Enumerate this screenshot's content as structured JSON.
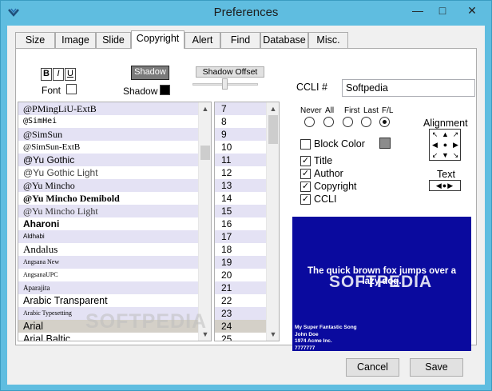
{
  "window": {
    "title": "Preferences"
  },
  "tabs": [
    {
      "label": "Size",
      "active": false
    },
    {
      "label": "Image",
      "active": false
    },
    {
      "label": "Slide",
      "active": false
    },
    {
      "label": "Copyright",
      "active": true
    },
    {
      "label": "Alert",
      "active": false
    },
    {
      "label": "Find",
      "active": false
    },
    {
      "label": "Database",
      "active": false
    },
    {
      "label": "Misc.",
      "active": false
    }
  ],
  "font_controls": {
    "bold": "B",
    "italic": "I",
    "underline": "U",
    "font_label": "Font",
    "shadow_button": "Shadow",
    "shadow_label": "Shadow",
    "shadow_offset_button": "Shadow Offset",
    "shadow_color": "#000000",
    "font_color": "#ffffff"
  },
  "font_list": [
    {
      "name": "@PMingLiU-ExtB",
      "style": "serif",
      "selected": false
    },
    {
      "name": "@SimHei",
      "style": "sans-narrow",
      "selected": false
    },
    {
      "name": "@SimSun",
      "style": "serif",
      "selected": false
    },
    {
      "name": "@SimSun-ExtB",
      "style": "serif",
      "selected": false
    },
    {
      "name": "@Yu Gothic",
      "style": "sans",
      "selected": false
    },
    {
      "name": "@Yu Gothic Light",
      "style": "sans-light",
      "selected": false
    },
    {
      "name": "@Yu Mincho",
      "style": "serif",
      "selected": false
    },
    {
      "name": "@Yu Mincho Demibold",
      "style": "serif-bold",
      "selected": false
    },
    {
      "name": "@Yu Mincho Light",
      "style": "serif-light",
      "selected": false
    },
    {
      "name": "Aharoni",
      "style": "sans-bold",
      "selected": false
    },
    {
      "name": "Aldhabi",
      "style": "tiny",
      "selected": false
    },
    {
      "name": "Andalus",
      "style": "serif",
      "selected": false
    },
    {
      "name": "Angsana New",
      "style": "tiny-serif",
      "selected": false
    },
    {
      "name": "AngsanaUPC",
      "style": "tiny-serif",
      "selected": false
    },
    {
      "name": "Aparajita",
      "style": "tiny-serif",
      "selected": false
    },
    {
      "name": "Arabic Transparent",
      "style": "sans",
      "selected": false
    },
    {
      "name": "Arabic Typesetting",
      "style": "tiny-serif",
      "selected": false
    },
    {
      "name": "Arial",
      "style": "sans",
      "selected": true
    },
    {
      "name": "Arial Baltic",
      "style": "sans",
      "selected": false
    }
  ],
  "size_list": [
    {
      "value": "7",
      "selected": false
    },
    {
      "value": "8",
      "selected": false
    },
    {
      "value": "9",
      "selected": false
    },
    {
      "value": "10",
      "selected": false
    },
    {
      "value": "11",
      "selected": false
    },
    {
      "value": "12",
      "selected": false
    },
    {
      "value": "13",
      "selected": false
    },
    {
      "value": "14",
      "selected": false
    },
    {
      "value": "15",
      "selected": false
    },
    {
      "value": "16",
      "selected": false
    },
    {
      "value": "17",
      "selected": false
    },
    {
      "value": "18",
      "selected": false
    },
    {
      "value": "19",
      "selected": false
    },
    {
      "value": "20",
      "selected": false
    },
    {
      "value": "21",
      "selected": false
    },
    {
      "value": "22",
      "selected": false
    },
    {
      "value": "23",
      "selected": false
    },
    {
      "value": "24",
      "selected": true
    },
    {
      "value": "25",
      "selected": false
    }
  ],
  "ccli": {
    "label": "CCLI #",
    "value": "Softpedia"
  },
  "position_radios": {
    "labels": [
      "Never",
      "All",
      "First",
      "Last",
      "F/L"
    ],
    "selected": "F/L"
  },
  "block_color": {
    "label": "Block Color",
    "checked": false,
    "color": "#8c8c8c"
  },
  "checkboxes": [
    {
      "label": "Title",
      "checked": true
    },
    {
      "label": "Author",
      "checked": true
    },
    {
      "label": "Copyright",
      "checked": true
    },
    {
      "label": "CCLI",
      "checked": true
    }
  ],
  "alignment": {
    "label": "Alignment",
    "text_label": "Text"
  },
  "preview": {
    "background": "#0a0a9e",
    "main_text": "The quick brown fox jumps over a lazy dog.",
    "watermark": "SOFTPEDIA",
    "meta_lines": [
      "My Super Fantastic Song",
      "John Doe",
      "1974 Acme Inc.",
      "7777777"
    ]
  },
  "watermark_text": "SOFTPEDIA",
  "buttons": {
    "cancel": "Cancel",
    "save": "Save"
  }
}
